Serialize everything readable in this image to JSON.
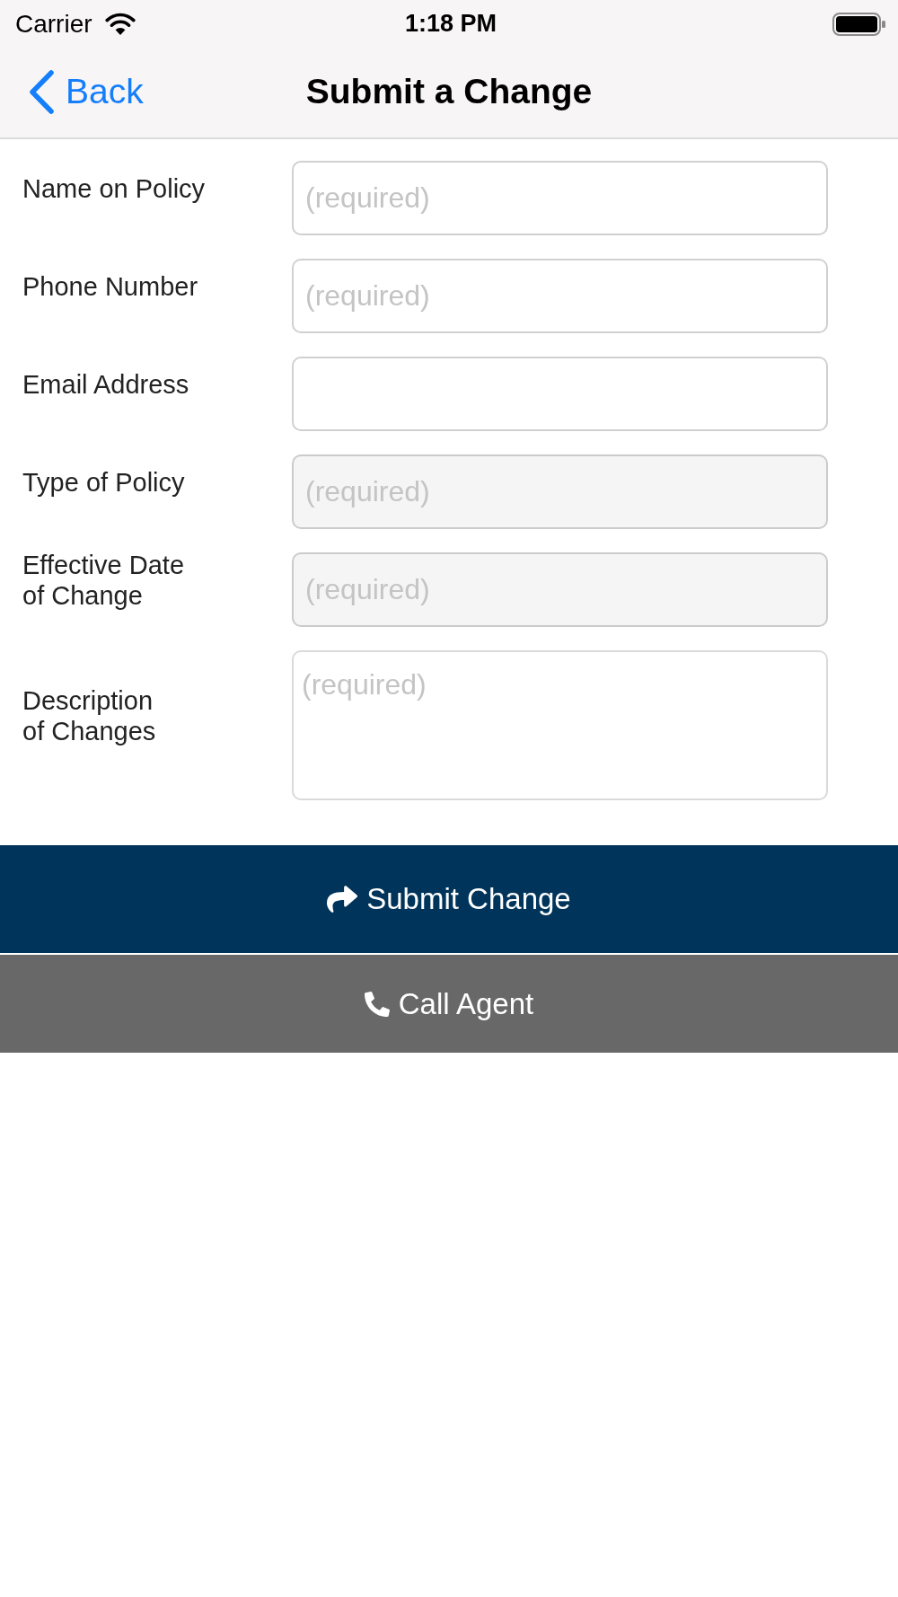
{
  "status_bar": {
    "carrier": "Carrier",
    "time": "1:18 PM"
  },
  "nav_bar": {
    "back": "Back",
    "title": "Submit a Change"
  },
  "form": {
    "fields": [
      {
        "kind": "input",
        "label": "Name on Policy",
        "placeholder": "(required)"
      },
      {
        "kind": "input",
        "label": "Phone Number",
        "placeholder": "(required)"
      },
      {
        "kind": "input",
        "label": "Email Address"
      },
      {
        "kind": "picker",
        "label": "Type of Policy",
        "placeholder": "(required)"
      },
      {
        "kind": "picker",
        "label": "Effective Date\nof Change",
        "placeholder": "(required)"
      },
      {
        "kind": "textarea",
        "label": "Description\nof Changes",
        "placeholder": "(required)"
      }
    ]
  },
  "actions": [
    {
      "kind": "submit",
      "label": "Submit Change"
    },
    {
      "kind": "call",
      "label": "Call Agent"
    }
  ]
}
